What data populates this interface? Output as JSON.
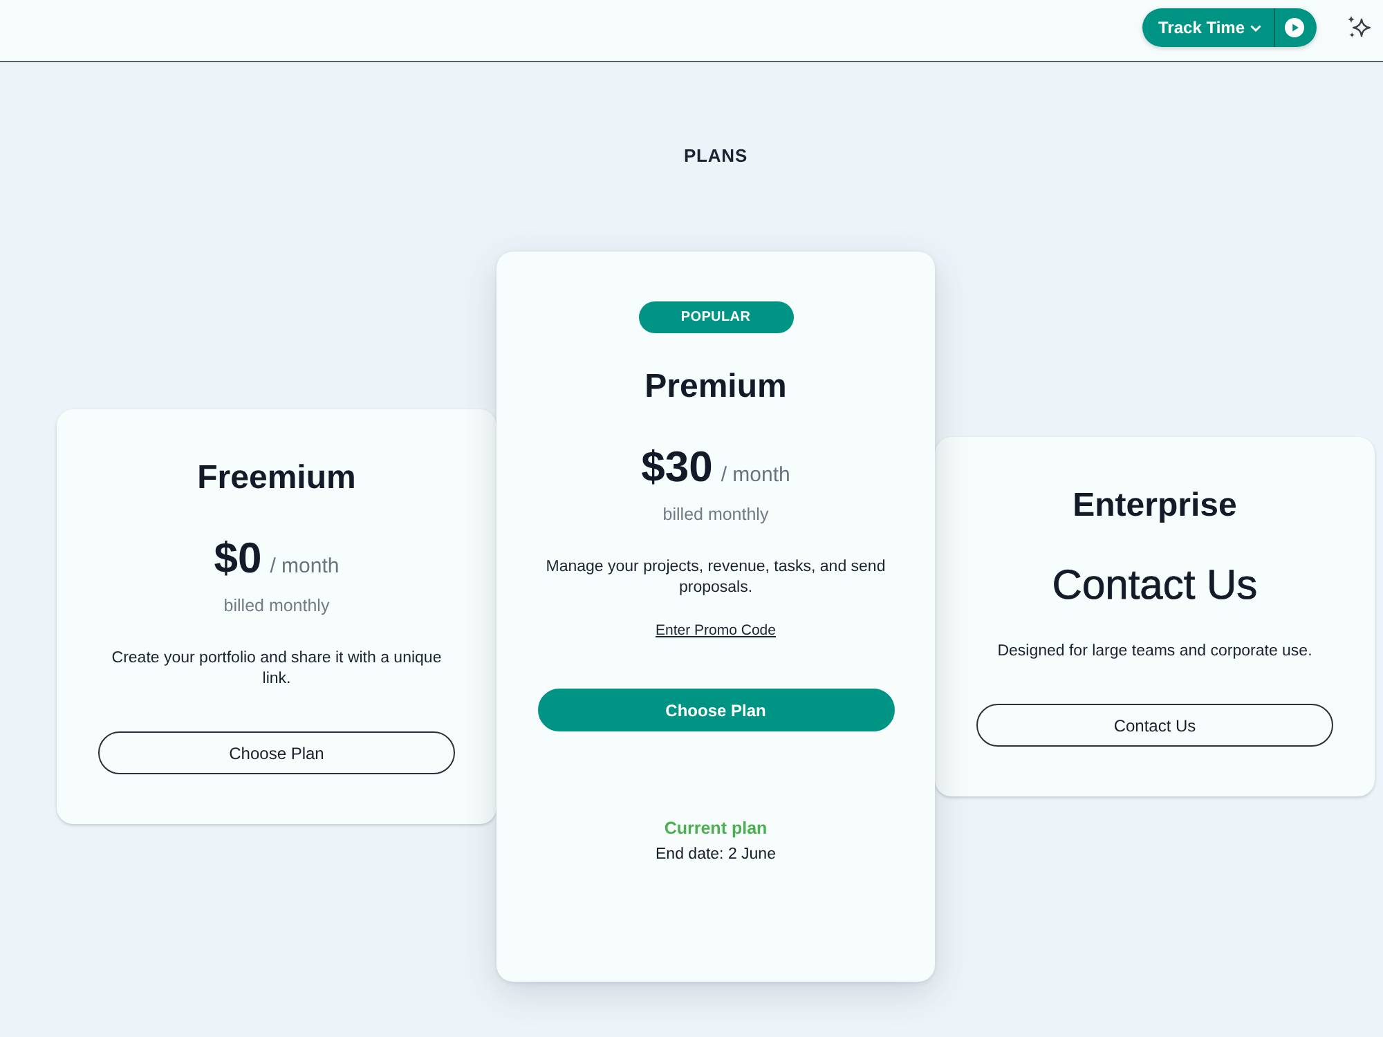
{
  "header": {
    "track_time": {
      "label": "Track Time"
    }
  },
  "title": "PLANS",
  "plans": [
    {
      "name": "Freemium",
      "featured": false,
      "price": "$0",
      "period": "/ month",
      "billing": "billed monthly",
      "description": "Create your portfolio and share it with a unique link.",
      "button": {
        "label": "Choose Plan",
        "primary": false
      }
    },
    {
      "name": "Premium",
      "featured": true,
      "badge": "POPULAR",
      "price": "$30",
      "period": "/ month",
      "billing": "billed monthly",
      "description": "Manage your projects, revenue, tasks, and send proposals.",
      "promo_link": "Enter Promo Code",
      "button": {
        "label": "Choose Plan",
        "primary": true
      },
      "status": "Current plan",
      "end_date": "End date: 2 June"
    },
    {
      "name": "Enterprise",
      "featured": false,
      "price": "Contact Us",
      "description": "Designed for large teams and corporate use.",
      "button": {
        "label": "Contact Us",
        "primary": false
      }
    }
  ]
}
